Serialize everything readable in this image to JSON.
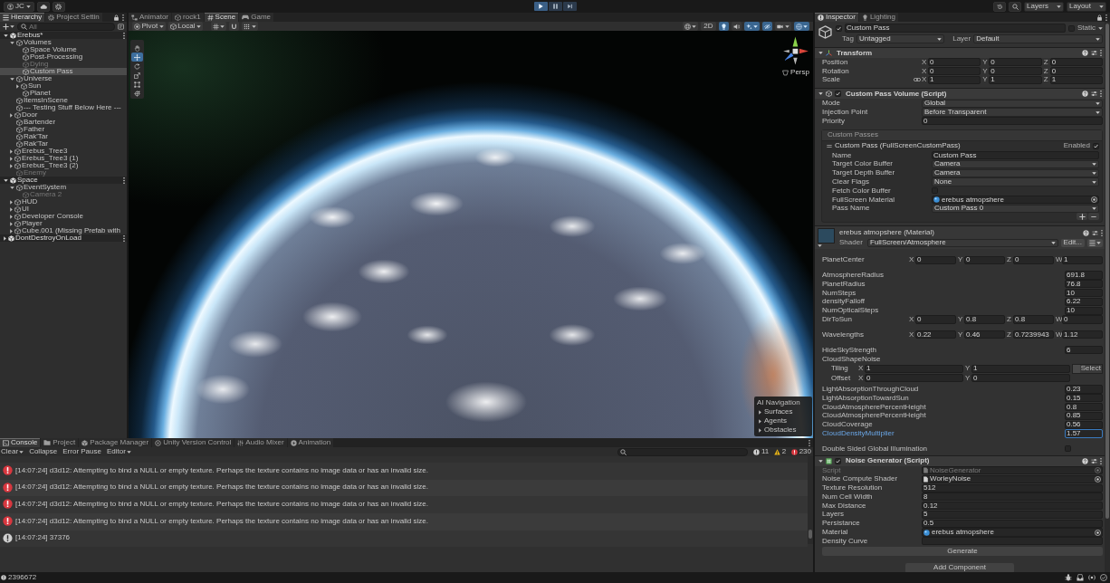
{
  "toolbar": {
    "account": "JC",
    "play_controls": [
      {
        "kind": "play",
        "selected": true
      },
      {
        "kind": "pause",
        "selected": false
      },
      {
        "kind": "step",
        "selected": false
      }
    ],
    "layers": "Layers",
    "layout": "Layout"
  },
  "hierarchy": {
    "tabs": [
      {
        "label": "Hierarchy",
        "kind": "hierarchy",
        "selected": true
      },
      {
        "label": "Project Settin",
        "kind": "settings",
        "selected": false
      }
    ],
    "search": {
      "placeholder": "All"
    },
    "tree": [
      {
        "label": "Erebus*",
        "kind": "scene",
        "selected": false,
        "active": true,
        "expanded": true,
        "children": [
          {
            "label": "Volumes",
            "kind": "object",
            "selected": false,
            "active": true,
            "expanded": true,
            "children": [
              {
                "label": "Space Volume",
                "kind": "object",
                "selected": false,
                "active": true
              },
              {
                "label": "Post-Processing",
                "kind": "object",
                "selected": false,
                "active": true
              },
              {
                "label": "Dying",
                "kind": "object",
                "selected": false,
                "active": false
              },
              {
                "label": "Custom Pass",
                "kind": "object",
                "selected": true,
                "active": true
              }
            ]
          },
          {
            "label": "Universe",
            "kind": "object",
            "selected": false,
            "active": true,
            "expanded": true,
            "children": [
              {
                "label": "Sun",
                "kind": "object",
                "selected": false,
                "active": true,
                "expanded": false
              },
              {
                "label": "Planet",
                "kind": "object",
                "selected": false,
                "active": true
              }
            ]
          },
          {
            "label": "ItemsInScene",
            "kind": "object",
            "selected": false,
            "active": true
          },
          {
            "label": "--- Testing Stuff Below Here ---",
            "kind": "object",
            "selected": false,
            "active": true
          },
          {
            "label": "Door",
            "kind": "object",
            "selected": false,
            "active": true,
            "expanded": false
          },
          {
            "label": "Bartender",
            "kind": "object",
            "selected": false,
            "active": true
          },
          {
            "label": "Father",
            "kind": "object",
            "selected": false,
            "active": true
          },
          {
            "label": "Rak'Tar",
            "kind": "object",
            "selected": false,
            "active": true
          },
          {
            "label": "Rak'Tar",
            "kind": "object",
            "selected": false,
            "active": true
          },
          {
            "label": "Erebus_Tree3",
            "kind": "object",
            "selected": false,
            "active": true,
            "expanded": false
          },
          {
            "label": "Erebus_Tree3 (1)",
            "kind": "object",
            "selected": false,
            "active": true,
            "expanded": false
          },
          {
            "label": "Erebus_Tree3 (2)",
            "kind": "object",
            "selected": false,
            "active": true,
            "expanded": false
          },
          {
            "label": "Enemy",
            "kind": "object",
            "selected": false,
            "active": false
          }
        ]
      },
      {
        "label": "Space",
        "kind": "scene",
        "selected": false,
        "active": true,
        "expanded": true,
        "children": [
          {
            "label": "EventSystem",
            "kind": "object",
            "selected": false,
            "active": true,
            "expanded": true,
            "children": [
              {
                "label": "Camera 2",
                "kind": "object",
                "selected": false,
                "active": false
              }
            ]
          },
          {
            "label": "HUD",
            "kind": "object",
            "selected": false,
            "active": true,
            "expanded": false
          },
          {
            "label": "UI",
            "kind": "object",
            "selected": false,
            "active": true,
            "expanded": false
          },
          {
            "label": "Developer Console",
            "kind": "object",
            "selected": false,
            "active": true,
            "expanded": false
          },
          {
            "label": "Player",
            "kind": "object",
            "selected": false,
            "active": true,
            "expanded": false
          },
          {
            "label": "Cube.001 (Missing Prefab with",
            "kind": "object",
            "selected": false,
            "active": true,
            "expanded": false
          }
        ]
      },
      {
        "label": "DontDestroyOnLoad",
        "kind": "scene",
        "selected": false,
        "active": true,
        "expanded": false
      }
    ]
  },
  "scene_view": {
    "tabs": [
      {
        "label": "Animator",
        "kind": "animator",
        "selected": false
      },
      {
        "label": "rock1",
        "kind": "model",
        "selected": false
      },
      {
        "label": "Scene",
        "kind": "scene",
        "selected": true
      },
      {
        "label": "Game",
        "kind": "game",
        "selected": false
      }
    ],
    "toolbar": {
      "pivot": "Pivot",
      "space": "Local",
      "mode_2d": "2D",
      "toggles": [
        {
          "kind": "lighting",
          "on": true
        },
        {
          "kind": "audio",
          "on": false
        },
        {
          "kind": "effects",
          "on": true
        },
        {
          "kind": "visibility",
          "on": true
        },
        {
          "kind": "camera",
          "on": false
        },
        {
          "kind": "gizmos",
          "on": true
        }
      ]
    },
    "tools": [
      {
        "kind": "hand",
        "selected": false
      },
      {
        "kind": "move",
        "selected": true
      },
      {
        "kind": "rotate",
        "selected": false
      },
      {
        "kind": "scale",
        "selected": false
      },
      {
        "kind": "rect",
        "selected": false
      },
      {
        "kind": "transform",
        "selected": false
      }
    ],
    "projection": "Persp",
    "overlay": {
      "title": "AI Navigation",
      "items": [
        {
          "label": "Surfaces",
          "expanded": false
        },
        {
          "label": "Agents",
          "expanded": false
        },
        {
          "label": "Obstacles",
          "expanded": false
        }
      ]
    }
  },
  "console": {
    "tabs": [
      {
        "label": "Console",
        "kind": "console",
        "selected": true
      },
      {
        "label": "Project",
        "kind": "folder",
        "selected": false
      },
      {
        "label": "Package Manager",
        "kind": "package",
        "selected": false
      },
      {
        "label": "Unity Version Control",
        "kind": "version_control",
        "selected": false
      },
      {
        "label": "Audio Mixer",
        "kind": "mixer",
        "selected": false
      },
      {
        "label": "Animation",
        "kind": "animation",
        "selected": false
      }
    ],
    "toolbar": {
      "clear": "Clear",
      "collapse": "Collapse",
      "error_pause": "Error Pause",
      "editor": "Editor"
    },
    "counters": [
      {
        "kind": "info",
        "count": "11"
      },
      {
        "kind": "warning",
        "count": "2"
      },
      {
        "kind": "error",
        "count": "230"
      }
    ],
    "entries": [
      {
        "kind": "error",
        "text": "[14:07:24] d3d12: Attempting to bind a NULL or empty texture. Perhaps the texture contains no image data or has an invalid size."
      },
      {
        "kind": "error",
        "text": "[14:07:24] d3d12: Attempting to bind a NULL or empty texture. Perhaps the texture contains no image data or has an invalid size."
      },
      {
        "kind": "error",
        "text": "[14:07:24] d3d12: Attempting to bind a NULL or empty texture. Perhaps the texture contains no image data or has an invalid size."
      },
      {
        "kind": "error",
        "text": "[14:07:24] d3d12: Attempting to bind a NULL or empty texture. Perhaps the texture contains no image data or has an invalid size."
      },
      {
        "kind": "log",
        "text": "[14:07:24] 37376"
      }
    ]
  },
  "inspector": {
    "tabs": [
      {
        "label": "Inspector",
        "kind": "inspector",
        "selected": true
      },
      {
        "label": "Lighting",
        "kind": "lighting",
        "selected": false
      }
    ],
    "object": {
      "active": true,
      "name": "Custom Pass",
      "static_label": "Static",
      "static": false,
      "tag_label": "Tag",
      "tag": "Untagged",
      "layer_label": "Layer",
      "layer": "Default"
    },
    "components": [
      {
        "kind": "transform",
        "title": "Transform",
        "expanded": true,
        "rows": [
          {
            "label": "Position",
            "kind": "vector",
            "fields": [
              {
                "axis": "X",
                "value": "0"
              },
              {
                "axis": "Y",
                "value": "0"
              },
              {
                "axis": "Z",
                "value": "0"
              }
            ]
          },
          {
            "label": "Rotation",
            "kind": "vector",
            "fields": [
              {
                "axis": "X",
                "value": "0"
              },
              {
                "axis": "Y",
                "value": "0"
              },
              {
                "axis": "Z",
                "value": "0"
              }
            ]
          },
          {
            "label": "Scale",
            "kind": "vector_linked",
            "fields": [
              {
                "axis": "X",
                "value": "1"
              },
              {
                "axis": "Y",
                "value": "1"
              },
              {
                "axis": "Z",
                "value": "1"
              }
            ]
          }
        ]
      },
      {
        "kind": "volume",
        "title": "Custom Pass Volume (Script)",
        "expanded": true,
        "enabled": true,
        "rows": [
          {
            "label": "Mode",
            "kind": "dropdown",
            "value": "Global"
          },
          {
            "label": "Injection Point",
            "kind": "dropdown",
            "value": "Before Transparent"
          },
          {
            "label": "Priority",
            "kind": "field",
            "value": "0"
          }
        ],
        "list": {
          "title": "Custom Passes",
          "items": [
            {
              "title": "Custom Pass (FullScreenCustomPass)",
              "enabled_label": "Enabled",
              "enabled": true,
              "rows": [
                {
                  "label": "Name",
                  "kind": "field",
                  "value": "Custom Pass"
                },
                {
                  "label": "Target Color Buffer",
                  "kind": "dropdown",
                  "value": "Camera"
                },
                {
                  "label": "Target Depth Buffer",
                  "kind": "dropdown",
                  "value": "Camera"
                },
                {
                  "label": "Clear Flags",
                  "kind": "dropdown",
                  "value": "None"
                },
                {
                  "label": "Fetch Color Buffer",
                  "kind": "checkbox",
                  "checked": false
                },
                {
                  "label": "FullScreen Material",
                  "kind": "material",
                  "value": "erebus atmopshere"
                },
                {
                  "label": "Pass Name",
                  "kind": "dropdown",
                  "value": "Custom Pass 0"
                }
              ]
            }
          ]
        }
      },
      {
        "kind": "material",
        "title": "erebus atmopshere (Material)",
        "expanded": true,
        "shader": {
          "label": "Shader",
          "value": "FullScreen/Atmosphere"
        },
        "edit_button": "Edit...",
        "groups": [
          [
            {
              "label": "PlanetCenter",
              "kind": "vector",
              "focused": false,
              "fields": [
                {
                  "axis": "X",
                  "value": "0"
                },
                {
                  "axis": "Y",
                  "value": "0"
                },
                {
                  "axis": "Z",
                  "value": "0"
                },
                {
                  "axis": "W",
                  "value": "1"
                }
              ]
            }
          ],
          [
            {
              "label": "AtmosphereRadius",
              "kind": "float",
              "focused": false,
              "value": "691.8"
            },
            {
              "label": "PlanetRadius",
              "kind": "float",
              "focused": false,
              "value": "76.8"
            },
            {
              "label": "NumSteps",
              "kind": "float",
              "focused": false,
              "value": "10"
            },
            {
              "label": "densityFalloff",
              "kind": "float",
              "focused": false,
              "value": "6.22"
            },
            {
              "label": "NumOpticalSteps",
              "kind": "float",
              "focused": false,
              "value": "10"
            },
            {
              "label": "DirToSun",
              "kind": "vector",
              "focused": false,
              "fields": [
                {
                  "axis": "X",
                  "value": "0"
                },
                {
                  "axis": "Y",
                  "value": "0.8"
                },
                {
                  "axis": "Z",
                  "value": "0.8"
                },
                {
                  "axis": "W",
                  "value": "0"
                }
              ]
            }
          ],
          [
            {
              "label": "Wavelengths",
              "kind": "vector",
              "focused": false,
              "fields": [
                {
                  "axis": "X",
                  "value": "0.22"
                },
                {
                  "axis": "Y",
                  "value": "0.46"
                },
                {
                  "axis": "Z",
                  "value": "0.7239943"
                },
                {
                  "axis": "W",
                  "value": "1.12"
                }
              ]
            }
          ],
          [
            {
              "label": "HideSkyStrength",
              "kind": "float",
              "focused": false,
              "value": "6"
            },
            {
              "label": "CloudShapeNoise",
              "kind": "texture",
              "focused": false,
              "select": "Select",
              "sub_rows": [
                {
                  "label": "Tiling",
                  "fields": [
                    {
                      "axis": "X",
                      "value": "1"
                    },
                    {
                      "axis": "Y",
                      "value": "1"
                    }
                  ]
                },
                {
                  "label": "Offset",
                  "fields": [
                    {
                      "axis": "X",
                      "value": "0"
                    },
                    {
                      "axis": "Y",
                      "value": "0"
                    }
                  ]
                }
              ]
            },
            {
              "label": "LightAbsorptionThroughCloud",
              "kind": "float",
              "focused": false,
              "value": "0.23"
            },
            {
              "label": "LightAbsorptionTowardSun",
              "kind": "float",
              "focused": false,
              "value": "0.15"
            },
            {
              "label": "CloudAtmospherePercentHeight",
              "kind": "float",
              "focused": false,
              "value": "0.8"
            },
            {
              "label": "CloudAtmospherePercentHeight",
              "kind": "float",
              "focused": false,
              "value": "0.85"
            },
            {
              "label": "CloudCoverage",
              "kind": "float",
              "focused": false,
              "value": "0.56"
            },
            {
              "label": "CloudDensityMultiplier",
              "kind": "float",
              "focused": true,
              "value": "1.57"
            }
          ],
          [
            {
              "label": "Double Sided Global Illumination",
              "kind": "checkbox",
              "focused": false,
              "checked": false
            }
          ]
        ]
      },
      {
        "kind": "script",
        "title": "Noise Generator (Script)",
        "expanded": true,
        "enabled": true,
        "rows": [
          {
            "label": "Script",
            "kind": "script",
            "value": "NoiseGenerator",
            "disabled": true
          },
          {
            "label": "Noise Compute Shader",
            "kind": "shader",
            "value": "WorleyNoise",
            "disabled": false
          },
          {
            "label": "Texture Resolution",
            "kind": "field",
            "value": "512",
            "disabled": false
          },
          {
            "label": "Num Cell Width",
            "kind": "field",
            "value": "8",
            "disabled": false
          },
          {
            "label": "Max Distance",
            "kind": "field",
            "value": "0.12",
            "disabled": false
          },
          {
            "label": "Layers",
            "kind": "field",
            "value": "5",
            "disabled": false
          },
          {
            "label": "Persistance",
            "kind": "field",
            "value": "0.5",
            "disabled": false
          },
          {
            "label": "Material",
            "kind": "material",
            "value": "erebus atmopshere",
            "disabled": false
          },
          {
            "label": "Density Curve",
            "kind": "curve",
            "disabled": false
          }
        ],
        "button": "Generate"
      }
    ],
    "add_component": "Add Component"
  },
  "status_bar": {
    "text": "2396672"
  }
}
